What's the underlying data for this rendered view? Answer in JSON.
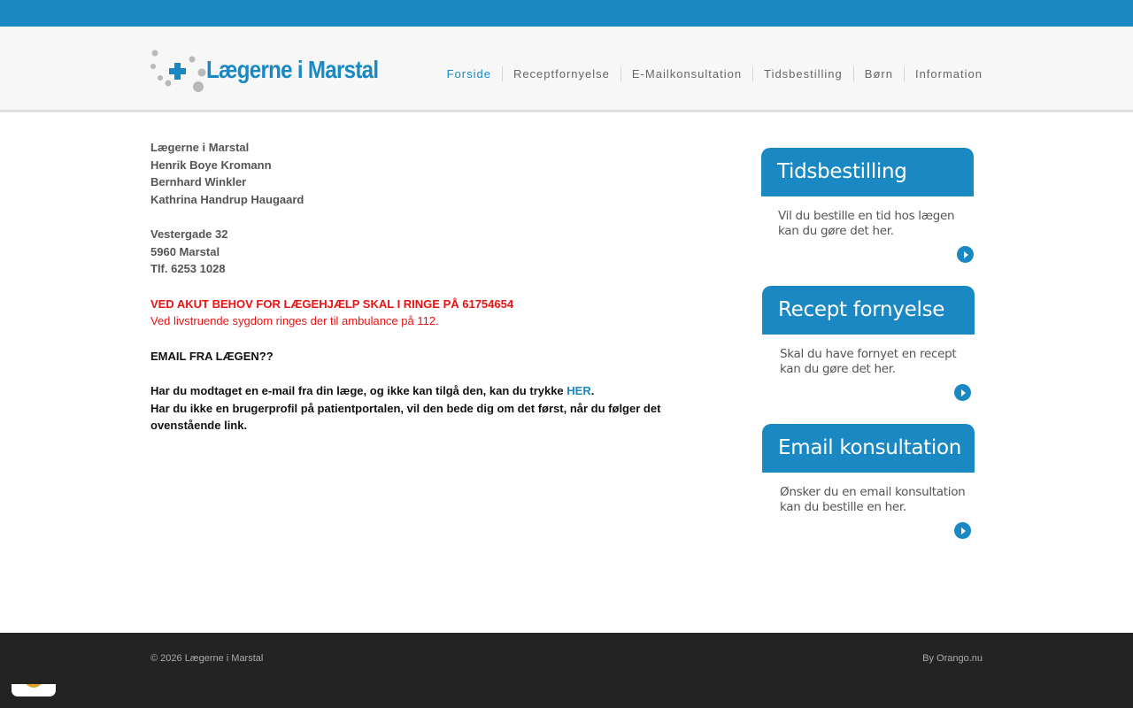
{
  "logo": {
    "text": "Lægerne i Marstal",
    "icon": "medical-cross-logo"
  },
  "nav": [
    {
      "label": "Forside",
      "active": true
    },
    {
      "label": "Receptfornyelse",
      "active": false
    },
    {
      "label": "E-Mailkonsultation",
      "active": false
    },
    {
      "label": "Tidsbestilling",
      "active": false
    },
    {
      "label": "Børn",
      "active": false
    },
    {
      "label": "Information",
      "active": false
    }
  ],
  "main": {
    "practice": [
      "Lægerne i Marstal",
      "Henrik Boye Kromann",
      "Bernhard Winkler",
      "Kathrina Handrup Haugaard"
    ],
    "address": [
      "Vestergade 32",
      "5960 Marstal",
      "Tlf. 6253 1028"
    ],
    "emergency": "VED AKUT BEHOV FOR LÆGEHJÆLP SKAL I RINGE PÅ 61754654",
    "ambulance": "Ved livstruende sygdom ringes der til ambulance på 112.",
    "email_heading": "EMAIL FRA LÆGEN??",
    "email_text_1": "Har du modtaget en e-mail fra din læge, og ikke kan tilgå den, kan du trykke ",
    "email_link": "HER",
    "email_text_1_end": ".",
    "email_text_2": "Har du ikke en brugerprofil på patientportalen, vil den bede dig om det først, når du følger det ovenstående link."
  },
  "widgets": [
    {
      "title": "Tidsbestilling",
      "line1": "Vil du bestille en tid hos lægen",
      "line2": "kan du gøre det her."
    },
    {
      "title": "Recept fornyelse",
      "line1": "Skal du have fornyet en recept",
      "line2": "kan du gøre det her."
    },
    {
      "title": "Email konsultation",
      "line1": "Ønsker du en email konsultation",
      "line2": "kan du bestille en her."
    }
  ],
  "footer": {
    "copyright": "© 2026 Lægerne i Marstal",
    "credit": "By Orango.nu"
  },
  "colors": {
    "brand": "#1a88c2",
    "alert": "#ee1111",
    "footer": "#232323"
  }
}
